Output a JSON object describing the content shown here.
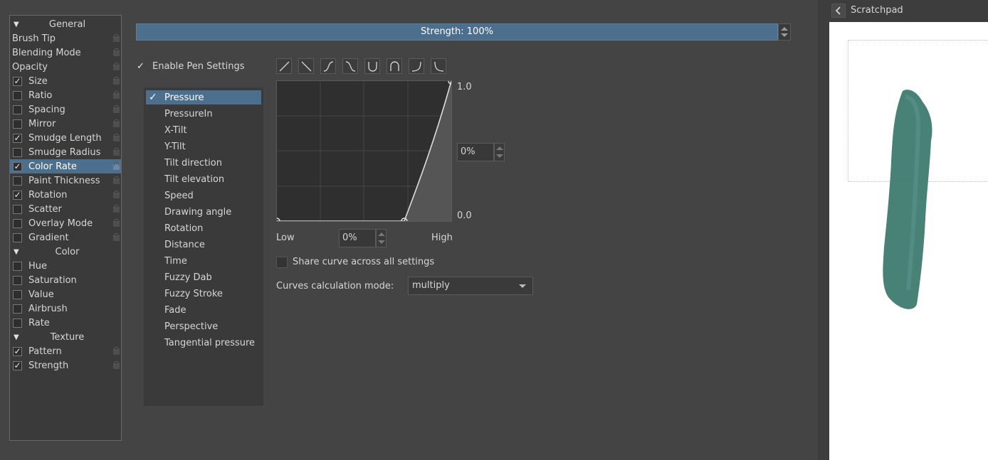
{
  "left_panel": {
    "rows": [
      {
        "kind": "section",
        "label": "General"
      },
      {
        "kind": "option",
        "label": "Brush Tip",
        "checkbox": false,
        "checked": false,
        "lock": true
      },
      {
        "kind": "option",
        "label": "Blending Mode",
        "checkbox": false,
        "checked": false,
        "lock": true
      },
      {
        "kind": "option",
        "label": "Opacity",
        "checkbox": false,
        "checked": false,
        "lock": true
      },
      {
        "kind": "option",
        "label": "Size",
        "checkbox": true,
        "checked": true,
        "lock": true
      },
      {
        "kind": "option",
        "label": "Ratio",
        "checkbox": true,
        "checked": false,
        "lock": true
      },
      {
        "kind": "option",
        "label": "Spacing",
        "checkbox": true,
        "checked": false,
        "lock": true
      },
      {
        "kind": "option",
        "label": "Mirror",
        "checkbox": true,
        "checked": false,
        "lock": true
      },
      {
        "kind": "option",
        "label": "Smudge Length",
        "checkbox": true,
        "checked": true,
        "lock": true
      },
      {
        "kind": "option",
        "label": "Smudge Radius",
        "checkbox": true,
        "checked": false,
        "lock": true
      },
      {
        "kind": "option",
        "label": "Color Rate",
        "checkbox": true,
        "checked": true,
        "lock": true,
        "selected": true
      },
      {
        "kind": "option",
        "label": "Paint Thickness",
        "checkbox": true,
        "checked": false,
        "lock": true
      },
      {
        "kind": "option",
        "label": "Rotation",
        "checkbox": true,
        "checked": true,
        "lock": true
      },
      {
        "kind": "option",
        "label": "Scatter",
        "checkbox": true,
        "checked": false,
        "lock": true
      },
      {
        "kind": "option",
        "label": "Overlay Mode",
        "checkbox": true,
        "checked": false,
        "lock": true
      },
      {
        "kind": "option",
        "label": "Gradient",
        "checkbox": true,
        "checked": false,
        "lock": true
      },
      {
        "kind": "section",
        "label": "Color"
      },
      {
        "kind": "option",
        "label": "Hue",
        "checkbox": true,
        "checked": false,
        "lock": false
      },
      {
        "kind": "option",
        "label": "Saturation",
        "checkbox": true,
        "checked": false,
        "lock": false
      },
      {
        "kind": "option",
        "label": "Value",
        "checkbox": true,
        "checked": false,
        "lock": false
      },
      {
        "kind": "option",
        "label": "Airbrush",
        "checkbox": true,
        "checked": false,
        "lock": false
      },
      {
        "kind": "option",
        "label": "Rate",
        "checkbox": true,
        "checked": false,
        "lock": false
      },
      {
        "kind": "section",
        "label": "Texture"
      },
      {
        "kind": "option",
        "label": "Pattern",
        "checkbox": true,
        "checked": true,
        "lock": true
      },
      {
        "kind": "option",
        "label": "Strength",
        "checkbox": true,
        "checked": true,
        "lock": true
      }
    ]
  },
  "strength_slider": {
    "text": "Strength: 100%",
    "value_percent": 100
  },
  "pen_settings": {
    "label": "Enable Pen Settings",
    "checked": true
  },
  "sensors": {
    "items": [
      "Pressure",
      "PressureIn",
      "X-Tilt",
      "Y-Tilt",
      "Tilt direction",
      "Tilt elevation",
      "Speed",
      "Drawing angle",
      "Rotation",
      "Distance",
      "Time",
      "Fuzzy Dab",
      "Fuzzy Stroke",
      "Fade",
      "Perspective",
      "Tangential pressure"
    ],
    "selected": "Pressure",
    "checked": [
      "Pressure"
    ]
  },
  "curve_presets": [
    "linear-icon",
    "reverse-linear-icon",
    "s-curve-icon",
    "reverse-s-curve-icon",
    "u-curve-icon",
    "arch-curve-icon",
    "j-curve-icon",
    "reverse-j-curve-icon"
  ],
  "curve": {
    "y_max_label": "1.0",
    "y_min_label": "0.0",
    "point_value": "0%",
    "low_label": "Low",
    "high_label": "High",
    "low_value": "0%",
    "points": [
      [
        0,
        0
      ],
      [
        0.73,
        0
      ],
      [
        1,
        1
      ]
    ]
  },
  "share_curve": {
    "label": "Share curve across all settings",
    "checked": false
  },
  "calc_mode": {
    "label": "Curves calculation mode:",
    "value": "multiply"
  },
  "scratchpad": {
    "title": "Scratchpad",
    "stroke_color": "#3e7a6f"
  },
  "colors": {
    "accent": "#4d6f8e",
    "background": "#444444"
  }
}
